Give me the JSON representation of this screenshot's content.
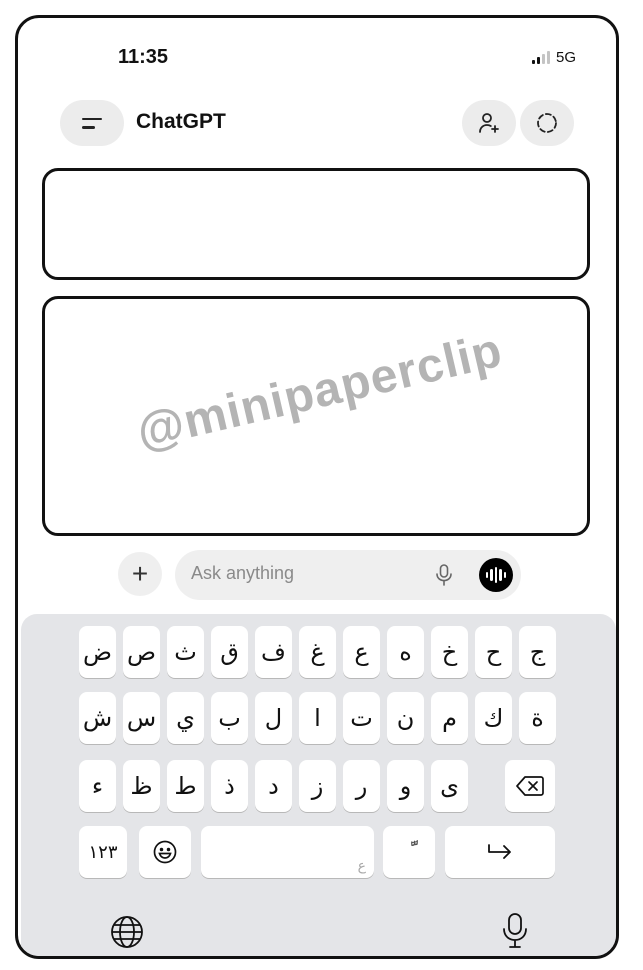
{
  "status_bar": {
    "time": "11:35",
    "network": "5G"
  },
  "header": {
    "title": "ChatGPT",
    "menu_icon": "menu-icon",
    "actions": [
      "add-person-icon",
      "temporary-chat-icon"
    ]
  },
  "watermark": "@minipaperclip",
  "composer": {
    "placeholder": "Ask anything",
    "attach_label": "+"
  },
  "keyboard": {
    "row1": [
      "ض",
      "ص",
      "ث",
      "ق",
      "ف",
      "غ",
      "ع",
      "ه",
      "خ",
      "ح",
      "ج"
    ],
    "row2": [
      "ش",
      "س",
      "ي",
      "ب",
      "ل",
      "ا",
      "ت",
      "ن",
      "م",
      "ك",
      "ة"
    ],
    "row3": [
      "ء",
      "ظ",
      "ط",
      "ذ",
      "د",
      "ز",
      "ر",
      "و",
      "ى"
    ],
    "numbers_key": "١٢٣",
    "space_hint": "ع",
    "diacritic_key": "ًّ",
    "delete_icon": "backspace-icon",
    "return_icon": "return-icon",
    "emoji_icon": "emoji-icon",
    "globe_icon": "globe-icon",
    "mic_icon": "mic-icon"
  }
}
